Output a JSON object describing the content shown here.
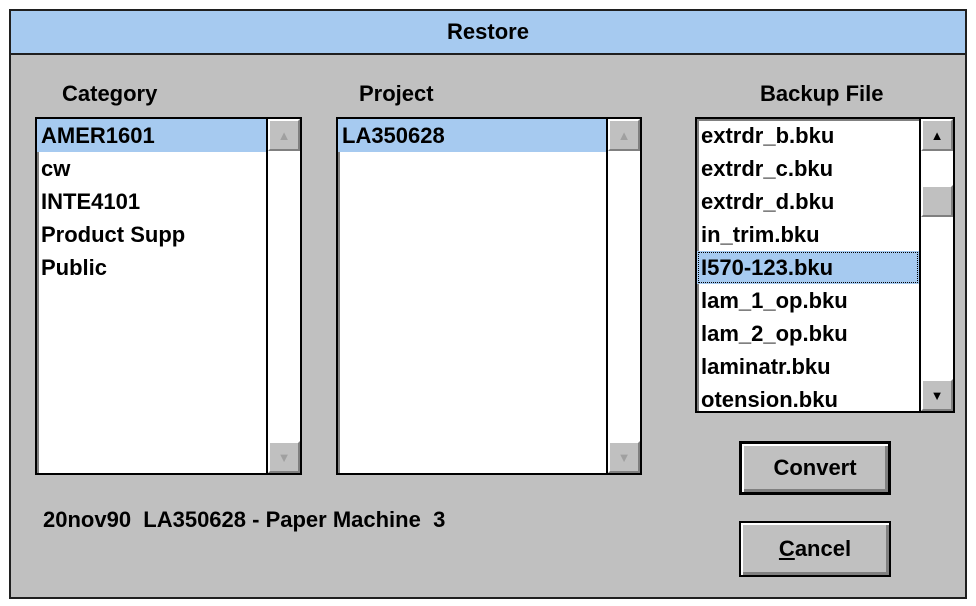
{
  "window": {
    "title": "Restore"
  },
  "category": {
    "label": "Category",
    "items": [
      "AMER1601",
      "cw",
      "INTE4101",
      "Product Supp",
      "Public"
    ],
    "selected_index": 0
  },
  "project": {
    "label": "Project",
    "items": [
      "LA350628"
    ],
    "selected_index": 0
  },
  "backup": {
    "label": "Backup File",
    "items": [
      "extrdr_b.bku",
      "extrdr_c.bku",
      "extrdr_d.bku",
      "in_trim.bku",
      "I570-123.bku",
      "lam_1_op.bku",
      "lam_2_op.bku",
      "laminatr.bku",
      "otension.bku"
    ],
    "selected_index": 4
  },
  "buttons": {
    "convert_label": "Convert",
    "cancel_first": "C",
    "cancel_rest": "ancel"
  },
  "status": {
    "text": "20nov90  LA350628 - Paper Machine  3"
  },
  "scroll": {
    "up_arrow": "▲",
    "down_arrow": "▼"
  },
  "colors": {
    "title_bar": "#a6caf0",
    "selection": "#a6caf0",
    "dialog_face": "#c0c0c0"
  }
}
